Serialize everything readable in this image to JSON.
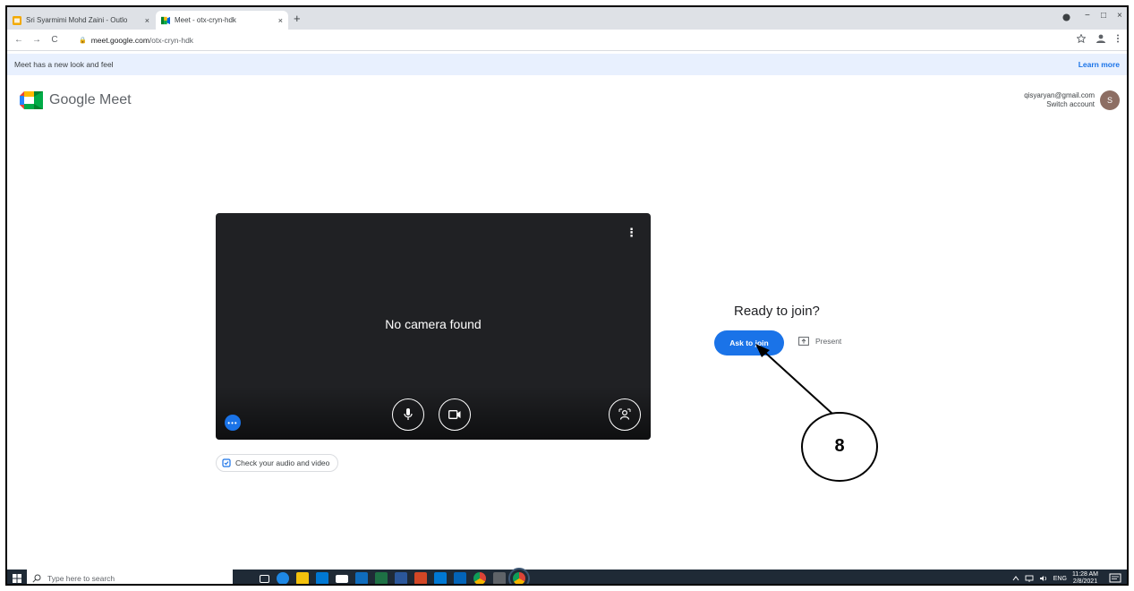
{
  "browser": {
    "tabs": [
      {
        "label": "Sri Syarmimi Mohd Zaini - Outlo",
        "close": "×"
      },
      {
        "label": "Meet - otx-cryn-hdk",
        "close": "×"
      }
    ],
    "new_tab": "+",
    "window_controls": {
      "minimize": "−",
      "maximize": "□",
      "close": "×"
    },
    "nav": {
      "back": "←",
      "forward": "→",
      "reload": "C"
    },
    "url_host": "meet.google.com",
    "url_path": "/otx-cryn-hdk",
    "lock": "🔒"
  },
  "banner": {
    "text": "Meet has a new look and feel",
    "link": "Learn more"
  },
  "header": {
    "logo_text": "Google Meet",
    "account_email": "qisyaryan@gmail.com",
    "switch_account": "Switch account",
    "avatar_initial": "S"
  },
  "preview": {
    "message": "No camera found",
    "menu_glyph": "⋮",
    "more_glyph": "•••"
  },
  "check_audio_video": "Check your audio and video",
  "join": {
    "heading": "Ready to join?",
    "ask_button": "Ask to join",
    "present_label": "Present"
  },
  "annotation": {
    "step": "8"
  },
  "taskbar": {
    "search_placeholder": "Type here to search",
    "language": "ENG",
    "time": "11:28 AM",
    "date": "2/8/2021"
  },
  "colors": {
    "accent": "#1a73e8",
    "preview_bg": "#202124",
    "banner_bg": "#e8f0fe",
    "taskbar_bg": "#1f2a36",
    "avatar_bg": "#8d6e63"
  }
}
